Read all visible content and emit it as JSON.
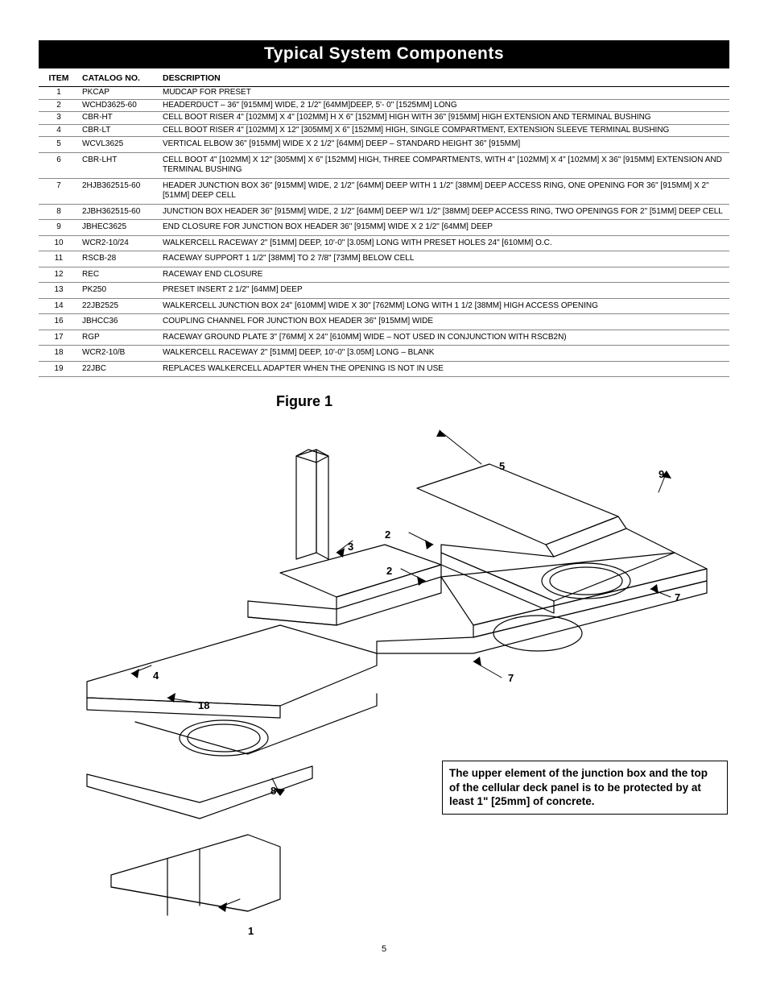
{
  "title": "Typical System Components",
  "headers": {
    "item": "ITEM",
    "catalog": "CATALOG NO.",
    "description": "DESCRIPTION"
  },
  "rows": [
    {
      "item": "1",
      "catalog": "PKCAP",
      "desc": "MUDCAP FOR PRESET",
      "tight": true
    },
    {
      "item": "2",
      "catalog": "WCHD3625-60",
      "desc": "HEADERDUCT – 36\" [915MM] WIDE, 2 1/2\" [64MM]DEEP, 5'- 0\" [1525MM] LONG",
      "tight": true
    },
    {
      "item": "3",
      "catalog": "CBR-HT",
      "desc": "CELL BOOT RISER 4\" [102MM] X 4\" [102MM] H X 6\" [152MM] HIGH WITH 36\" [915MM] HIGH EXTENSION AND TERMINAL BUSHING",
      "tight": true
    },
    {
      "item": "4",
      "catalog": "CBR-LT",
      "desc": "CELL BOOT RISER 4\" [102MM] X 12\" [305MM] X 6\" [152MM] HIGH, SINGLE COMPARTMENT, EXTENSION SLEEVE  TERMINAL BUSHING",
      "tight": true
    },
    {
      "item": "5",
      "catalog": "WCVL3625",
      "desc": "VERTICAL ELBOW 36\" [915MM] WIDE X 2 1/2\" [64MM] DEEP – STANDARD HEIGHT 36\" [915MM]"
    },
    {
      "item": "6",
      "catalog": "CBR-LHT",
      "desc": "CELL BOOT 4\" [102MM] X 12\" [305MM] X 6\" [152MM] HIGH, THREE COMPARTMENTS,  WITH 4\" [102MM] X 4\" [102MM] X 36\" [915MM] EXTENSION AND TERMINAL BUSHING"
    },
    {
      "item": "7",
      "catalog": "2HJB362515-60",
      "desc": "HEADER JUNCTION BOX 36\" [915MM] WIDE, 2 1/2\" [64MM] DEEP WITH 1 1/2\" [38MM] DEEP ACCESS RING, ONE OPENING FOR 36\" [915MM] X 2\" [51MM] DEEP CELL"
    },
    {
      "item": "8",
      "catalog": "2JBH362515-60",
      "desc": "JUNCTION BOX HEADER 36\" [915MM] WIDE, 2 1/2\" [64MM] DEEP W/1 1/2\" [38MM] DEEP ACCESS RING, TWO OPENINGS FOR 2\" [51MM] DEEP CELL"
    },
    {
      "item": "9",
      "catalog": "JBHEC3625",
      "desc": "END CLOSURE FOR JUNCTION BOX HEADER 36\" [915MM] WIDE X 2 1/2\" [64MM] DEEP"
    },
    {
      "item": "10",
      "catalog": "WCR2-10/24",
      "desc": "WALKERCELL RACEWAY 2\" [51MM] DEEP, 10'-0\" [3.05M] LONG WITH PRESET HOLES 24\" [610MM] O.C."
    },
    {
      "item": "11",
      "catalog": "RSCB-28",
      "desc": "RACEWAY SUPPORT 1 1/2\" [38MM] TO 2 7/8\" [73MM] BELOW CELL"
    },
    {
      "item": "12",
      "catalog": "REC",
      "desc": "RACEWAY END CLOSURE"
    },
    {
      "item": "13",
      "catalog": "PK250",
      "desc": "PRESET INSERT 2 1/2\" [64MM] DEEP"
    },
    {
      "item": "14",
      "catalog": "22JB2525",
      "desc": "WALKERCELL JUNCTION BOX 24\" [610MM] WIDE X 30\" [762MM] LONG WITH 1 1/2 [38MM] HIGH ACCESS OPENING"
    },
    {
      "item": "16",
      "catalog": "JBHCC36",
      "desc": "COUPLING CHANNEL FOR JUNCTION BOX HEADER 36\" [915MM] WIDE"
    },
    {
      "item": "17",
      "catalog": "RGP",
      "desc": "RACEWAY GROUND PLATE 3\" [76MM] X 24\" [610MM] WIDE – NOT USED IN CONJUNCTION WITH RSCB2N)"
    },
    {
      "item": "18",
      "catalog": "WCR2-10/B",
      "desc": "WALKERCELL RACEWAY 2\" [51MM] DEEP, 10'-0\" [3.05M] LONG – BLANK"
    },
    {
      "item": "19",
      "catalog": "22JBC",
      "desc": "REPLACES WALKERCELL ADAPTER WHEN THE OPENING IS NOT IN USE"
    }
  ],
  "figure": {
    "title": "Figure 1",
    "callouts": {
      "c1": "1",
      "c2a": "2",
      "c2b": "2",
      "c3": "3",
      "c4": "4",
      "c5": "5",
      "c7a": "7",
      "c7b": "7",
      "c8": "8",
      "c9": "9",
      "c18": "18"
    },
    "note": "The upper element of the junction box and the top of the cellular deck panel is to be protected by at least 1\" [25mm] of concrete."
  },
  "page_number": "5"
}
